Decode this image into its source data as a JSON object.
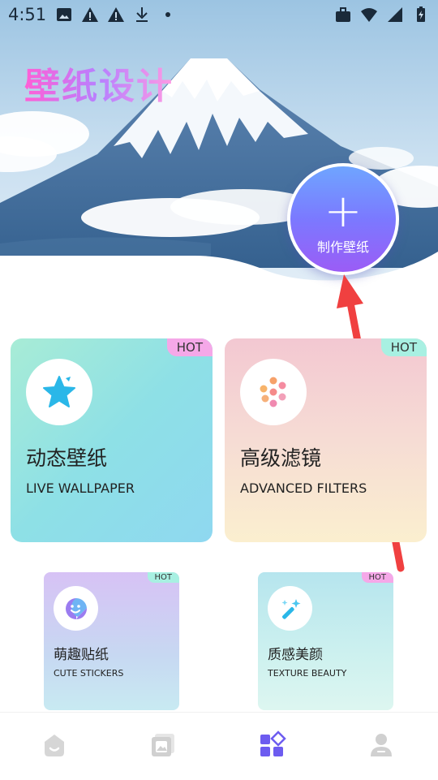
{
  "status_bar": {
    "time": "4:51"
  },
  "app": {
    "title": "壁纸设计"
  },
  "make_button": {
    "plus": "+",
    "label": "制作壁纸"
  },
  "cards": {
    "live": {
      "badge": "HOT",
      "title": "动态壁纸",
      "subtitle": "LIVE WALLPAPER",
      "icon": "star-icon"
    },
    "filters": {
      "badge": "HOT",
      "title": "高级滤镜",
      "subtitle": "ADVANCED FILTERS",
      "icon": "filter-dots-icon"
    },
    "stickers": {
      "badge": "HOT",
      "title": "萌趣贴纸",
      "subtitle": "CUTE STICKERS",
      "icon": "sticker-face-icon"
    },
    "beauty": {
      "badge": "HOT",
      "title": "质感美颜",
      "subtitle": "TEXTURE BEAUTY",
      "icon": "magic-wand-icon"
    }
  },
  "bottom_nav": {
    "items": [
      "home-icon",
      "gallery-icon",
      "apps-icon",
      "profile-icon"
    ],
    "active_index": 2
  },
  "colors": {
    "accent_purple": "#7b79ff",
    "hot_pink": "#f5a8e8",
    "hot_cyan": "#a8f0e2",
    "arrow_red": "#f04040"
  }
}
